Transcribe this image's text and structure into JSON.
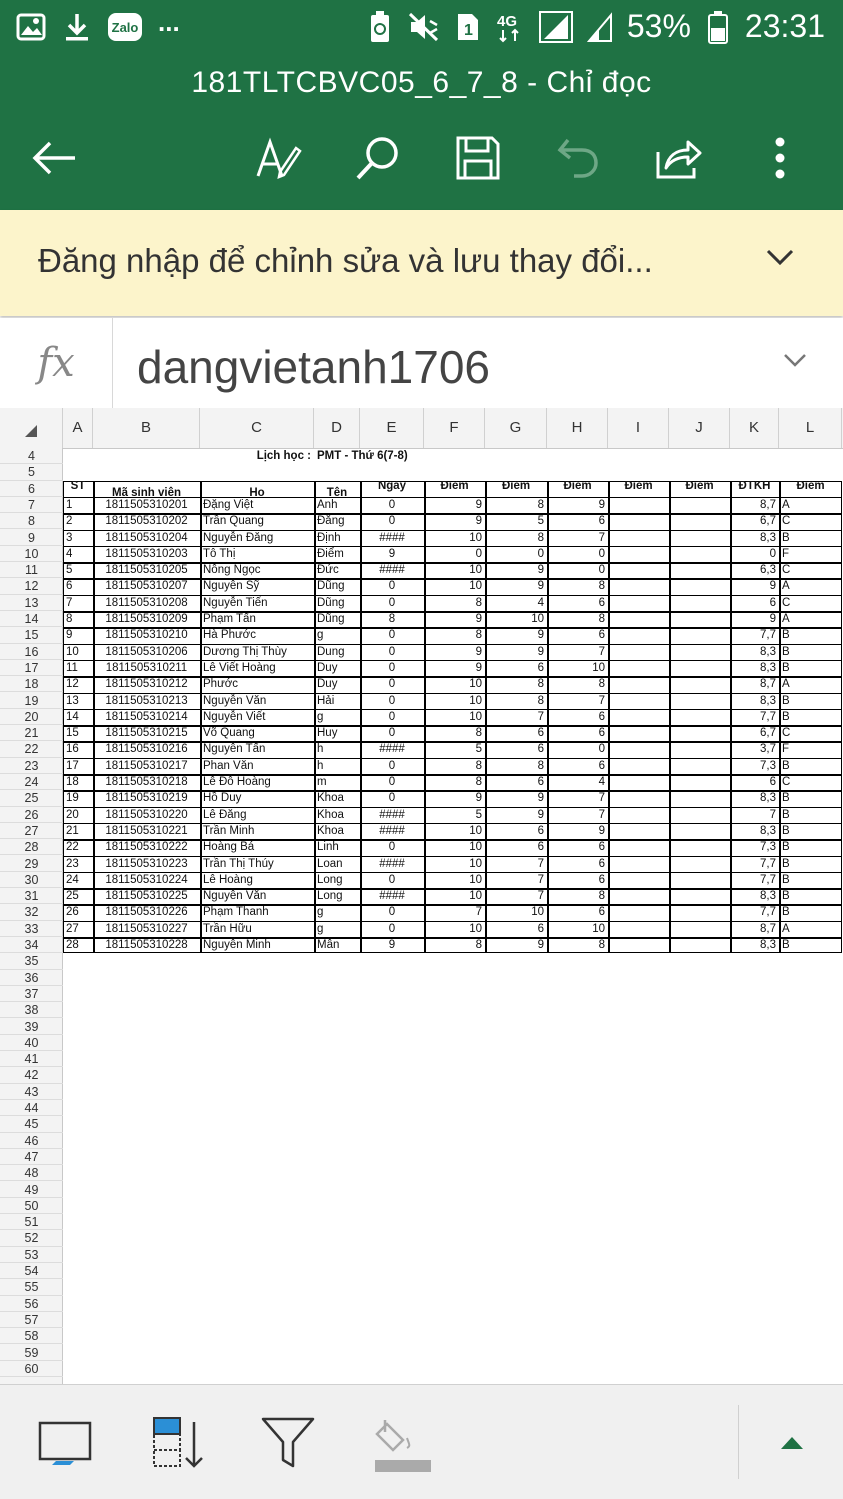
{
  "status": {
    "time": "23:31",
    "battery": "53%",
    "network": "4G",
    "sim": "1",
    "zalo": "Zalo",
    "more": "...",
    "accent": "#1f7244"
  },
  "doc": {
    "title": "181TLTCBVC05_6_7_8 - Chỉ đọc"
  },
  "banner": {
    "text": "Đăng nhập để chỉnh sửa và lưu thay đổi..."
  },
  "formula": {
    "label": "fx",
    "value": "dangvietanh1706"
  },
  "columns": [
    "A",
    "B",
    "C",
    "D",
    "E",
    "F",
    "G",
    "H",
    "I",
    "J",
    "K",
    "L"
  ],
  "rows": [
    "4",
    "5",
    "6",
    "7",
    "8",
    "9",
    "10",
    "11",
    "12",
    "13",
    "14",
    "15",
    "16",
    "17",
    "18",
    "19",
    "20",
    "21",
    "22",
    "23",
    "24",
    "25",
    "26",
    "27",
    "28",
    "29",
    "30",
    "31",
    "32",
    "33",
    "34",
    "35",
    "36",
    "37",
    "38",
    "39",
    "40",
    "41",
    "42",
    "43",
    "44",
    "45",
    "46",
    "47",
    "48",
    "49",
    "50",
    "51",
    "52",
    "53",
    "54",
    "55",
    "56",
    "57",
    "58",
    "59",
    "60"
  ],
  "sheet": {
    "schedule_label": "Lịch học :",
    "schedule_value": "PMT - Thứ 6(7-8)",
    "headers": [
      "ST",
      "Mã sinh viên",
      "Ho",
      "Tên",
      "Ngày",
      "Điểm",
      "Điểm",
      "Điểm",
      "Điểm",
      "Điểm",
      "ĐTKH",
      "Điểm"
    ],
    "data": [
      [
        "1",
        "1811505310201",
        "Đặng Việt",
        "Anh",
        "0",
        "9",
        "8",
        "9",
        "",
        "",
        "8,7",
        "A"
      ],
      [
        "2",
        "1811505310202",
        "Trần Quang",
        "Đăng",
        "0",
        "9",
        "5",
        "6",
        "",
        "",
        "6,7",
        "C"
      ],
      [
        "3",
        "1811505310204",
        "Nguyễn Đăng",
        "Định",
        "####",
        "10",
        "8",
        "7",
        "",
        "",
        "8,3",
        "B"
      ],
      [
        "4",
        "1811505310203",
        "Tô Thị",
        "Điểm",
        "9",
        "0",
        "0",
        "0",
        "",
        "",
        "0",
        "F"
      ],
      [
        "5",
        "1811505310205",
        "Nông Ngọc",
        "Đức",
        "####",
        "10",
        "9",
        "0",
        "",
        "",
        "6,3",
        "C"
      ],
      [
        "6",
        "1811505310207",
        "Nguyễn Sỹ",
        "Dũng",
        "0",
        "10",
        "9",
        "8",
        "",
        "",
        "9",
        "A"
      ],
      [
        "7",
        "1811505310208",
        "Nguyễn Tiến",
        "Dũng",
        "0",
        "8",
        "4",
        "6",
        "",
        "",
        "6",
        "C"
      ],
      [
        "8",
        "1811505310209",
        "Phạm Tấn",
        "Dũng",
        "8",
        "9",
        "10",
        "8",
        "",
        "",
        "9",
        "A"
      ],
      [
        "9",
        "1811505310210",
        "Hà Phước",
        "g",
        "0",
        "8",
        "9",
        "6",
        "",
        "",
        "7,7",
        "B"
      ],
      [
        "10",
        "1811505310206",
        "Dương Thị Thùy",
        "Dung",
        "0",
        "9",
        "9",
        "7",
        "",
        "",
        "8,3",
        "B"
      ],
      [
        "11",
        "1811505310211",
        "Lê Viết Hoàng",
        "Duy",
        "0",
        "9",
        "6",
        "10",
        "",
        "",
        "8,3",
        "B"
      ],
      [
        "12",
        "1811505310212",
        "Phước",
        "Duy",
        "0",
        "10",
        "8",
        "8",
        "",
        "",
        "8,7",
        "A"
      ],
      [
        "13",
        "1811505310213",
        "Nguyễn Văn",
        "Hải",
        "0",
        "10",
        "8",
        "7",
        "",
        "",
        "8,3",
        "B"
      ],
      [
        "14",
        "1811505310214",
        "Nguyễn Viết",
        "g",
        "0",
        "10",
        "7",
        "6",
        "",
        "",
        "7,7",
        "B"
      ],
      [
        "15",
        "1811505310215",
        "Võ Quang",
        "Huy",
        "0",
        "8",
        "6",
        "6",
        "",
        "",
        "6,7",
        "C"
      ],
      [
        "16",
        "1811505310216",
        "Nguyễn Tấn",
        "h",
        "####",
        "5",
        "6",
        "0",
        "",
        "",
        "3,7",
        "F"
      ],
      [
        "17",
        "1811505310217",
        "Phan Văn",
        "h",
        "0",
        "8",
        "8",
        "6",
        "",
        "",
        "7,3",
        "B"
      ],
      [
        "18",
        "1811505310218",
        "Lê Đỗ Hoàng",
        "m",
        "0",
        "8",
        "6",
        "4",
        "",
        "",
        "6",
        "C"
      ],
      [
        "19",
        "1811505310219",
        "Hồ Duy",
        "Khoa",
        "0",
        "9",
        "9",
        "7",
        "",
        "",
        "8,3",
        "B"
      ],
      [
        "20",
        "1811505310220",
        "Lê Đăng",
        "Khoa",
        "####",
        "5",
        "9",
        "7",
        "",
        "",
        "7",
        "B"
      ],
      [
        "21",
        "1811505310221",
        "Trần Minh",
        "Khoa",
        "####",
        "10",
        "6",
        "9",
        "",
        "",
        "8,3",
        "B"
      ],
      [
        "22",
        "1811505310222",
        "Hoàng Bá",
        "Linh",
        "0",
        "10",
        "6",
        "6",
        "",
        "",
        "7,3",
        "B"
      ],
      [
        "23",
        "1811505310223",
        "Trần Thị Thúy",
        "Loan",
        "####",
        "10",
        "7",
        "6",
        "",
        "",
        "7,7",
        "B"
      ],
      [
        "24",
        "1811505310224",
        "Lê Hoàng",
        "Long",
        "0",
        "10",
        "7",
        "6",
        "",
        "",
        "7,7",
        "B"
      ],
      [
        "25",
        "1811505310225",
        "Nguyễn Văn",
        "Long",
        "####",
        "10",
        "7",
        "8",
        "",
        "",
        "8,3",
        "B"
      ],
      [
        "26",
        "1811505310226",
        "Phạm Thanh",
        "g",
        "0",
        "7",
        "10",
        "6",
        "",
        "",
        "7,7",
        "B"
      ],
      [
        "27",
        "1811505310227",
        "Trần Hữu",
        "g",
        "0",
        "10",
        "6",
        "10",
        "",
        "",
        "8,7",
        "A"
      ],
      [
        "28",
        "1811505310228",
        "Nguyễn Minh",
        "Mẫn",
        "9",
        "8",
        "9",
        "8",
        "",
        "",
        "8,3",
        "B"
      ]
    ]
  }
}
